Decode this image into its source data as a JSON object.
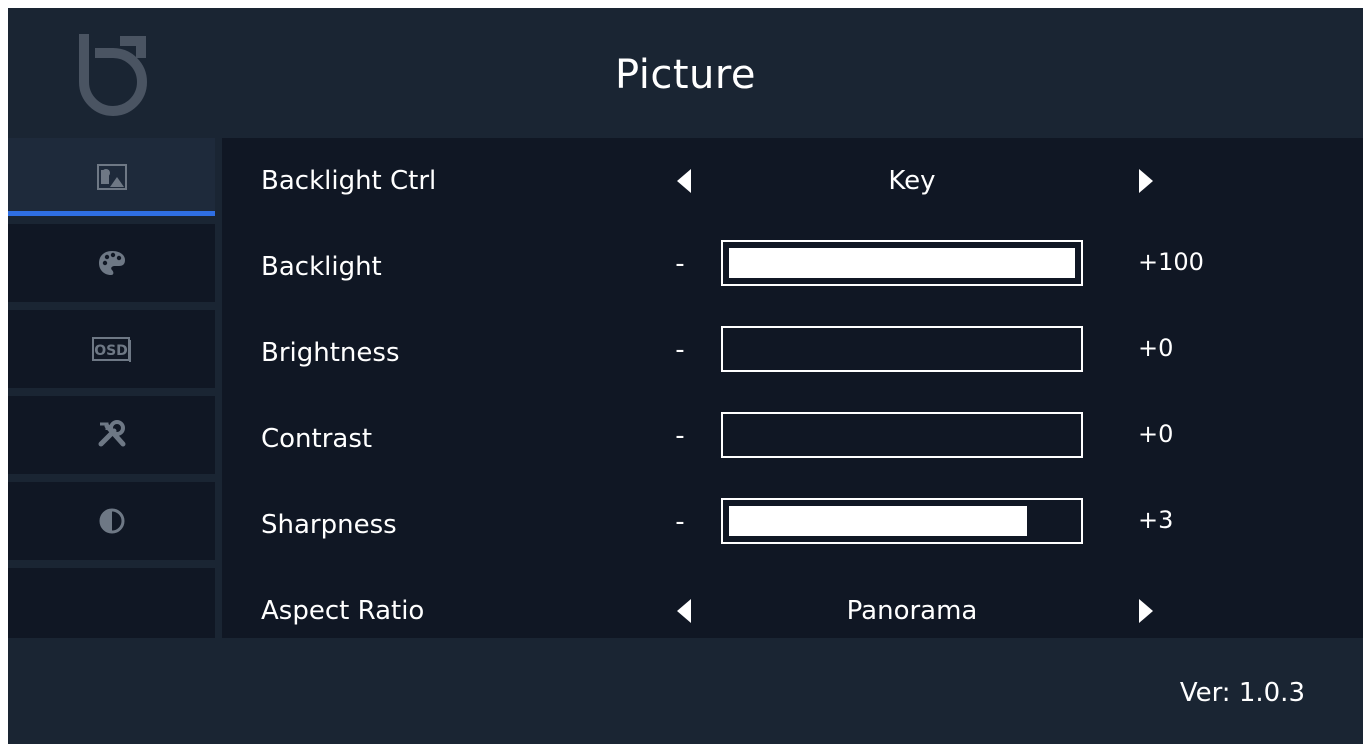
{
  "header": {
    "title": "Picture",
    "logo_icon": "brand-logo"
  },
  "sidebar": {
    "items": [
      {
        "name": "picture",
        "icon": "picture-icon",
        "active": true
      },
      {
        "name": "color",
        "icon": "palette-icon",
        "active": false
      },
      {
        "name": "osd",
        "icon": "osd-icon",
        "active": false,
        "icon_text": "OSD"
      },
      {
        "name": "setup",
        "icon": "tools-icon",
        "active": false
      },
      {
        "name": "contrast-mode",
        "icon": "half-circle-icon",
        "active": false
      },
      {
        "name": "empty",
        "icon": "",
        "active": false
      }
    ]
  },
  "settings": {
    "backlight_ctrl": {
      "label": "Backlight Ctrl",
      "value": "Key"
    },
    "backlight": {
      "label": "Backlight",
      "minus": "-",
      "value": "+100",
      "level": 100
    },
    "brightness": {
      "label": "Brightness",
      "minus": "-",
      "value": "+0",
      "level": 0
    },
    "contrast": {
      "label": "Contrast",
      "minus": "-",
      "value": "+0",
      "level": 0
    },
    "sharpness": {
      "label": "Sharpness",
      "minus": "-",
      "value": "+3",
      "level": 86
    },
    "aspect_ratio": {
      "label": "Aspect Ratio",
      "value": "Panorama"
    }
  },
  "footer": {
    "version": "Ver: 1.0.3"
  },
  "colors": {
    "background": "#1a2533",
    "panel": "#101724",
    "accent": "#2f6fe3",
    "text": "#ffffff"
  }
}
